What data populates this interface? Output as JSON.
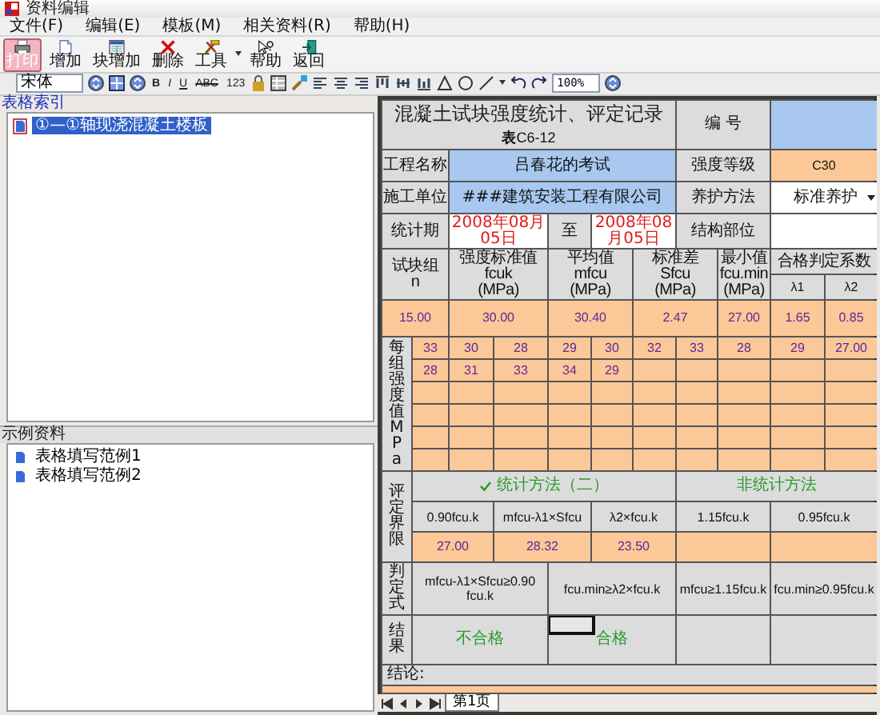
{
  "window": {
    "title": "资料编辑"
  },
  "menu": [
    {
      "label": "文件(F)"
    },
    {
      "label": "编辑(E)"
    },
    {
      "label": "模板(M)"
    },
    {
      "label": "相关资料(R)"
    },
    {
      "label": "帮助(H)"
    }
  ],
  "toolbar": [
    {
      "kind": "print",
      "label": "打印",
      "selected": true
    },
    {
      "kind": "add",
      "label": "增加",
      "selected": false
    },
    {
      "kind": "block-add",
      "label": "块增加",
      "selected": false
    },
    {
      "kind": "delete",
      "label": "删除",
      "selected": false
    },
    {
      "kind": "tools",
      "label": "工具",
      "selected": false
    },
    {
      "kind": "help",
      "label": "帮助",
      "selected": false
    },
    {
      "kind": "return",
      "label": "返回",
      "selected": false
    }
  ],
  "format_bar": {
    "font": "宋体",
    "style_buttons": [
      {
        "kind": "bold",
        "text": "B"
      },
      {
        "kind": "italic",
        "text": "I"
      },
      {
        "kind": "underline",
        "text": "U"
      },
      {
        "kind": "strike",
        "text": "ABC"
      },
      {
        "kind": "plain",
        "text": "123"
      }
    ],
    "zoom": "100%"
  },
  "index_panel": {
    "title": "表格索引",
    "items": [
      {
        "label": "①—①轴现浇混凝土楼板",
        "selected": true
      }
    ]
  },
  "examples_panel": {
    "title": "示例资料",
    "items": [
      {
        "label": "表格填写范例1",
        "selected": false
      },
      {
        "label": "表格填写范例2",
        "selected": false
      }
    ]
  },
  "form": {
    "title": "混凝土试块强度统计、评定记录",
    "code": "**表**C6-12",
    "number": {
      "label": "编 号"
    },
    "project": {
      "label": "工程名称",
      "value": "吕春花的考试"
    },
    "grade": {
      "label": "强度等级",
      "value": "C30"
    },
    "contractor": {
      "label": "施工单位",
      "value": "###建筑安装工程有限公司"
    },
    "curing": {
      "label": "养护方法",
      "value": "标准养护"
    },
    "period": {
      "label": "统计期",
      "from": "2008年08月05日",
      "to_label": "至",
      "to": "2008年08月05日"
    },
    "location": {
      "label": "结构部位"
    },
    "stat_headers": [
      {
        "title": "试块组",
        "sub": "n"
      },
      {
        "title": "强度标准值",
        "sub": "fcuk",
        "unit": "(MPa)"
      },
      {
        "title": "平均值",
        "sub": "mfcu",
        "unit": "(MPa)"
      },
      {
        "title": "标准差",
        "sub": "Sfcu",
        "unit": "(MPa)"
      },
      {
        "title": "最小值",
        "sub": "fcu.min",
        "unit": "(MPa)"
      },
      {
        "title": "合格判定系数"
      }
    ],
    "coef_headers": [
      "λ1",
      "λ2"
    ],
    "stat_values": [
      "15.00",
      "30.00",
      "30.40",
      "2.47",
      "27.00",
      "1.65",
      "0.85"
    ],
    "strength": {
      "label": "每组强度值MPa",
      "rows": [
        [
          "33",
          "30",
          "28",
          "29",
          "30",
          "32",
          "33",
          "28",
          "29",
          "27.00"
        ],
        [
          "28",
          "31",
          "33",
          "34",
          "29"
        ]
      ]
    },
    "criteria": {
      "label": "评定界限",
      "methods": [
        {
          "label": "统计方法（二）",
          "checked": true
        },
        {
          "label": "非统计方法",
          "checked": false
        }
      ],
      "formulas": [
        "0.90fcu.k",
        "mfcu-λ1×Sfcu",
        "λ2×fcu.k",
        "1.15fcu.k",
        "0.95fcu.k"
      ],
      "values": [
        "27.00",
        "28.32",
        "23.50"
      ]
    },
    "checks": {
      "label": "判定式",
      "formulas": [
        "mfcu-λ1×Sfcu≥0.90 fcu.k",
        "fcu.min≥λ2×fcu.k",
        "mfcu≥1.15fcu.k",
        "fcu.min≥0.95fcu.k"
      ]
    },
    "results": {
      "label": "结果",
      "items": [
        {
          "text": "不合格",
          "active": false
        },
        {
          "text": "合格",
          "active": true
        }
      ]
    },
    "conclusion": {
      "label": "结论:"
    }
  },
  "sheet_tabs": [
    {
      "label": "第1页",
      "selected": true
    }
  ]
}
